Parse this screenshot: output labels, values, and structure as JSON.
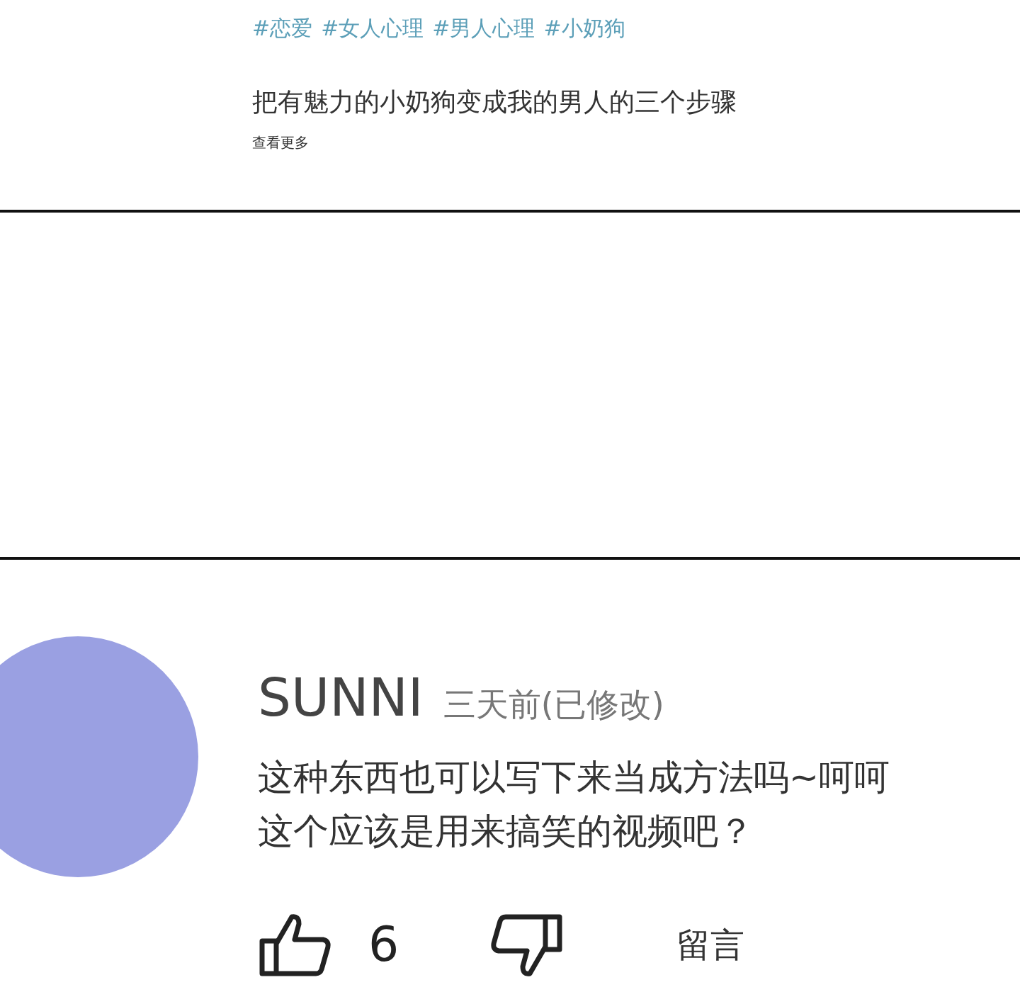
{
  "post": {
    "tags": [
      "#恋爱",
      "#女人心理",
      "#男人心理",
      "#小奶狗"
    ],
    "title": "把有魅力的小奶狗变成我的男人的三个步骤",
    "more_link": "查看更多"
  },
  "comment": {
    "author": "SUNNI",
    "time": "三天前(已修改)",
    "lines": [
      "这种东西也可以写下来当成方法吗~呵呵",
      "这个应该是用来搞笑的视频吧？"
    ],
    "like_count": "6",
    "reply_label": "留言"
  }
}
